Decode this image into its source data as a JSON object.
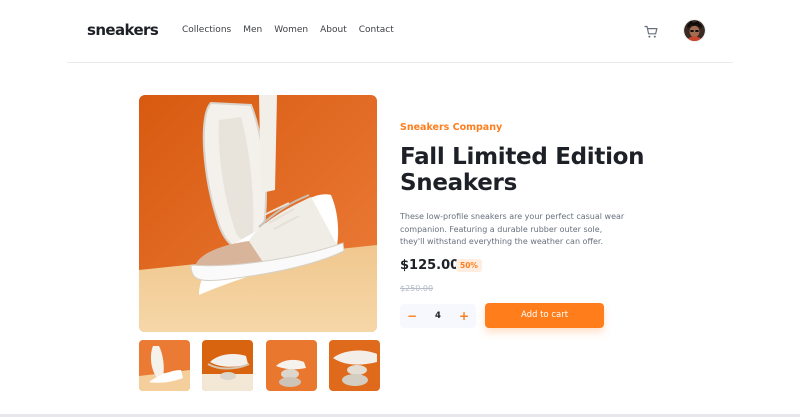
{
  "header": {
    "logo": "sneakers",
    "nav": [
      "Collections",
      "Men",
      "Women",
      "About",
      "Contact"
    ],
    "cart_icon": "cart-icon",
    "avatar_icon": "avatar"
  },
  "product": {
    "company": "Sneakers Company",
    "title": "Fall Limited Edition Sneakers",
    "description": "These low-profile sneakers are your perfect casual wear companion. Featuring a durable rubber outer sole, they'll withstand everything the weather can offer.",
    "price": "$125.00",
    "discount": "50%",
    "old_price": "$250.00",
    "quantity": "4",
    "minus_symbol": "−",
    "plus_symbol": "+",
    "add_to_cart": "Add to cart"
  },
  "gallery": {
    "thumbnails": [
      "thumbnail-1",
      "thumbnail-2",
      "thumbnail-3",
      "thumbnail-4"
    ]
  },
  "colors": {
    "accent": "#ff7e1b",
    "accent_light": "#ffede0",
    "text_dark": "#1d2026",
    "text_muted": "#68707d"
  }
}
